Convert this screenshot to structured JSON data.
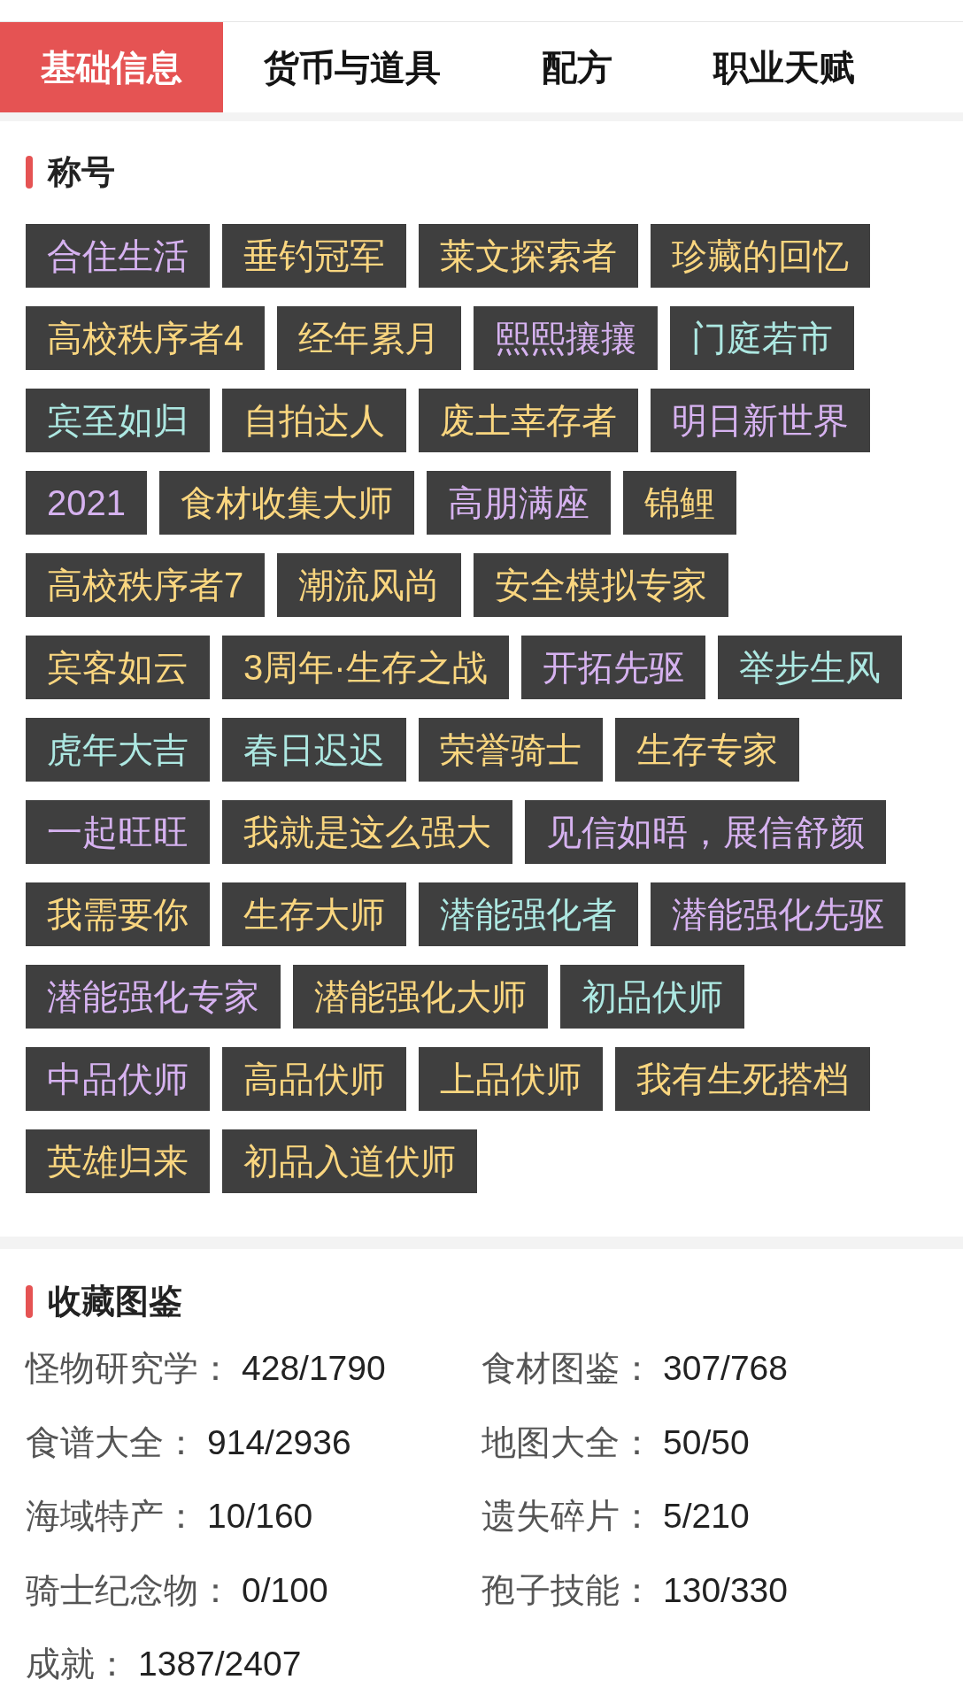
{
  "tabs": [
    {
      "label": "基础信息",
      "selected": true
    },
    {
      "label": "货币与道具",
      "selected": false
    },
    {
      "label": "配方",
      "selected": false
    },
    {
      "label": "职业天赋",
      "selected": false
    }
  ],
  "titles": {
    "heading": "称号",
    "items": [
      {
        "label": "合住生活",
        "color": "#d6b2f0"
      },
      {
        "label": "垂钓冠军",
        "color": "#fad67f"
      },
      {
        "label": "莱文探索者",
        "color": "#fad67f"
      },
      {
        "label": "珍藏的回忆",
        "color": "#fad67f"
      },
      {
        "label": "高校秩序者4",
        "color": "#fad67f"
      },
      {
        "label": "经年累月",
        "color": "#fad67f"
      },
      {
        "label": "熙熙攘攘",
        "color": "#d6b2f0"
      },
      {
        "label": "门庭若市",
        "color": "#ade8e2"
      },
      {
        "label": "宾至如归",
        "color": "#ade8e2"
      },
      {
        "label": "自拍达人",
        "color": "#fad67f"
      },
      {
        "label": "废土幸存者",
        "color": "#fad67f"
      },
      {
        "label": "明日新世界",
        "color": "#d6b2f0"
      },
      {
        "label": "2021",
        "color": "#d6b2f0"
      },
      {
        "label": "食材收集大师",
        "color": "#fad67f"
      },
      {
        "label": "高朋满座",
        "color": "#d6b2f0"
      },
      {
        "label": "锦鲤",
        "color": "#fad67f"
      },
      {
        "label": "高校秩序者7",
        "color": "#fad67f"
      },
      {
        "label": "潮流风尚",
        "color": "#fad67f"
      },
      {
        "label": "安全模拟专家",
        "color": "#fad67f"
      },
      {
        "label": "宾客如云",
        "color": "#fad67f"
      },
      {
        "label": "3周年·生存之战",
        "color": "#fad67f"
      },
      {
        "label": "开拓先驱",
        "color": "#d6b2f0"
      },
      {
        "label": "举步生风",
        "color": "#ade8e2"
      },
      {
        "label": "虎年大吉",
        "color": "#ade8e2"
      },
      {
        "label": "春日迟迟",
        "color": "#ade8e2"
      },
      {
        "label": "荣誉骑士",
        "color": "#fad67f"
      },
      {
        "label": "生存专家",
        "color": "#fad67f"
      },
      {
        "label": "一起旺旺",
        "color": "#d6b2f0"
      },
      {
        "label": "我就是这么强大",
        "color": "#fad67f"
      },
      {
        "label": "见信如晤，展信舒颜",
        "color": "#d6b2f0"
      },
      {
        "label": "我需要你",
        "color": "#fad67f"
      },
      {
        "label": "生存大师",
        "color": "#fad67f"
      },
      {
        "label": "潜能强化者",
        "color": "#ade8e2"
      },
      {
        "label": "潜能强化先驱",
        "color": "#d6b2f0"
      },
      {
        "label": "潜能强化专家",
        "color": "#d6b2f0"
      },
      {
        "label": "潜能强化大师",
        "color": "#fad67f"
      },
      {
        "label": "初品伏师",
        "color": "#ade8e2"
      },
      {
        "label": "中品伏师",
        "color": "#d6b2f0"
      },
      {
        "label": "高品伏师",
        "color": "#fad67f"
      },
      {
        "label": "上品伏师",
        "color": "#fad67f"
      },
      {
        "label": "我有生死搭档",
        "color": "#fad67f"
      },
      {
        "label": "英雄归来",
        "color": "#fad67f"
      },
      {
        "label": "初品入道伏师",
        "color": "#fad67f"
      }
    ]
  },
  "collection": {
    "heading": "收藏图鉴",
    "stats": [
      {
        "label": "怪物研究学：",
        "value": "428/1790"
      },
      {
        "label": "食材图鉴：",
        "value": "307/768"
      },
      {
        "label": "食谱大全：",
        "value": "914/2936"
      },
      {
        "label": "地图大全：",
        "value": "50/50"
      },
      {
        "label": "海域特产：",
        "value": "10/160"
      },
      {
        "label": "遗失碎片：",
        "value": "5/210"
      },
      {
        "label": "骑士纪念物：",
        "value": "0/100"
      },
      {
        "label": "孢子技能：",
        "value": "130/330"
      },
      {
        "label": "成就：",
        "value": "1387/2407"
      }
    ]
  }
}
